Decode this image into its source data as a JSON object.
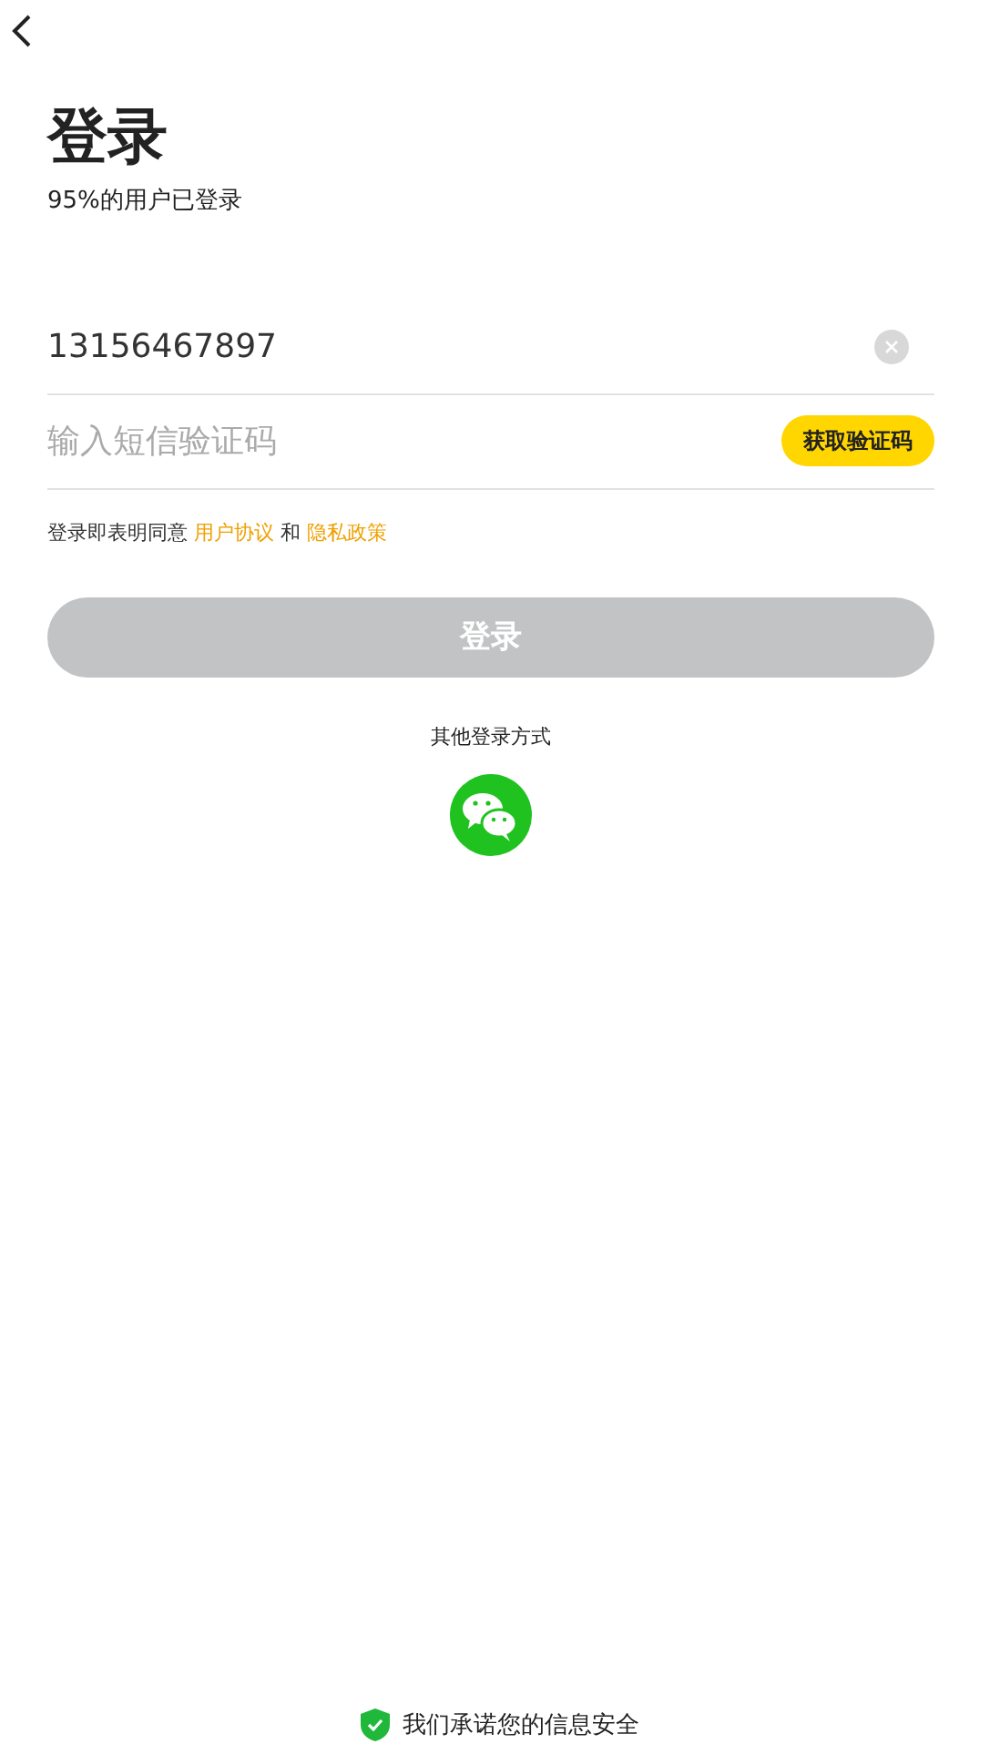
{
  "title": "登录",
  "subtitle": "95%的用户已登录",
  "phone_field": {
    "value": "13156467897"
  },
  "code_field": {
    "placeholder": "输入短信验证码"
  },
  "get_code_button": {
    "label": "获取验证码"
  },
  "agreement": {
    "prefix": "登录即表明同意",
    "link_1": "用户协议",
    "joiner": "和",
    "link_2": "隐私政策"
  },
  "login_button": {
    "label": "登录",
    "disabled": true
  },
  "other_methods": {
    "label": "其他登录方式"
  },
  "footer": {
    "text": "我们承诺您的信息安全"
  }
}
